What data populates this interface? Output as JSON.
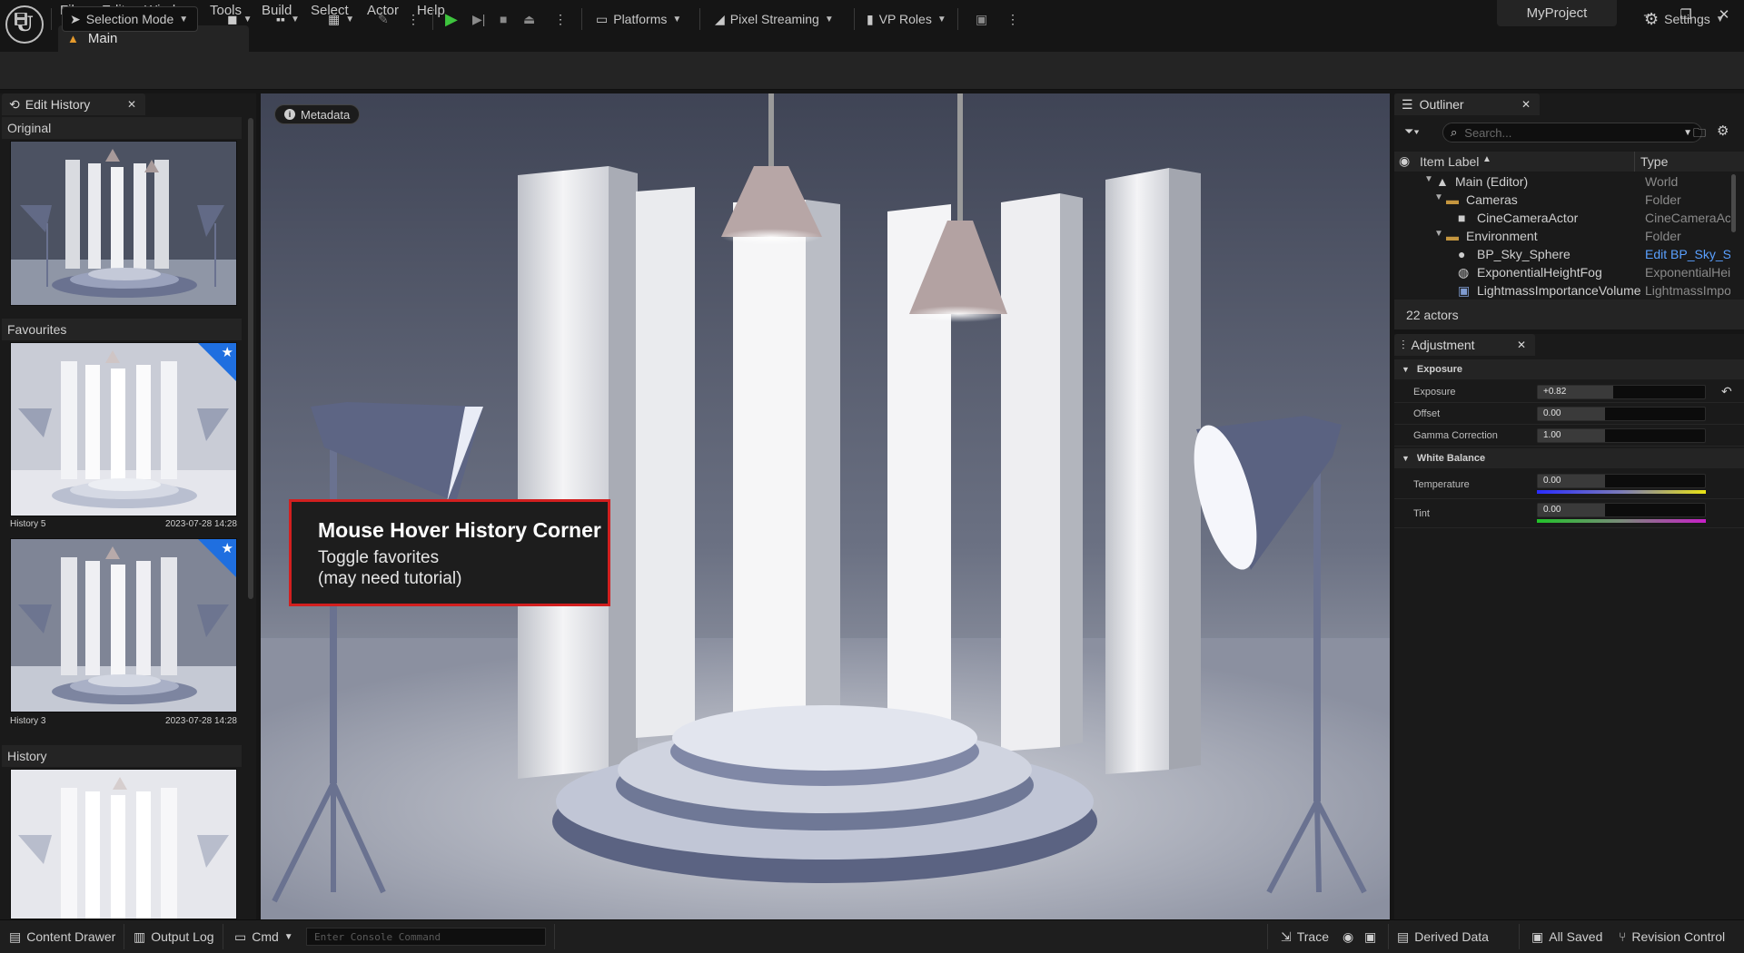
{
  "menu": [
    "File",
    "Edit",
    "Window",
    "Tools",
    "Build",
    "Select",
    "Actor",
    "Help"
  ],
  "level_tab": "Main",
  "project_name": "MyProject",
  "window_controls": {
    "minimize": "–",
    "restore": "❐",
    "close": "✕"
  },
  "toolbar": {
    "selection_mode": "Selection Mode",
    "platforms": "Platforms",
    "pixel_streaming": "Pixel Streaming",
    "vp_roles": "VP Roles",
    "settings": "Settings"
  },
  "edit_history": {
    "tab_label": "Edit History",
    "original_label": "Original",
    "favourites_label": "Favourites",
    "history_label": "History",
    "favourites": [
      {
        "name": "History 5",
        "timestamp": "2023-07-28 14:28"
      },
      {
        "name": "History 3",
        "timestamp": "2023-07-28 14:28"
      }
    ]
  },
  "viewport": {
    "metadata_button": "Metadata",
    "tooltip": {
      "heading": "Mouse Hover History Corner",
      "line1": "Toggle favorites",
      "line2": "(may need tutorial)"
    }
  },
  "outliner": {
    "tab_label": "Outliner",
    "search_placeholder": "Search...",
    "col_item_label": "Item Label",
    "col_type": "Type",
    "rows": [
      {
        "name": "Main (Editor)",
        "type": "World"
      },
      {
        "name": "Cameras",
        "type": "Folder"
      },
      {
        "name": "CineCameraActor",
        "type": "CineCameraAc"
      },
      {
        "name": "Environment",
        "type": "Folder"
      },
      {
        "name": "BP_Sky_Sphere",
        "type": "Edit BP_Sky_S"
      },
      {
        "name": "ExponentialHeightFog",
        "type": "ExponentialHei"
      },
      {
        "name": "LightmassImportanceVolume",
        "type": "LightmassImpo"
      }
    ],
    "actor_count": "22 actors"
  },
  "adjustment": {
    "tab_label": "Adjustment",
    "exposure_section": "Exposure",
    "white_balance_section": "White Balance",
    "exposure": {
      "label": "Exposure",
      "value": "+0.82",
      "fill": 0.45
    },
    "offset": {
      "label": "Offset",
      "value": "0.00",
      "fill": 0.4
    },
    "gamma": {
      "label": "Gamma Correction",
      "value": "1.00",
      "fill": 0.4
    },
    "temperature": {
      "label": "Temperature",
      "value": "0.00",
      "fill": 0.4
    },
    "tint": {
      "label": "Tint",
      "value": "0.00",
      "fill": 0.4
    }
  },
  "statusbar": {
    "content_drawer": "Content Drawer",
    "output_log": "Output Log",
    "cmd": "Cmd",
    "console_placeholder": "Enter Console Command",
    "trace": "Trace",
    "derived_data": "Derived Data",
    "all_saved": "All Saved",
    "revision_control": "Revision Control"
  },
  "colors": {
    "accent_play": "#3ec43e",
    "favourite_corner": "#1f6fe0",
    "tooltip_border": "#d21f1f",
    "link": "#5aa0ff"
  }
}
